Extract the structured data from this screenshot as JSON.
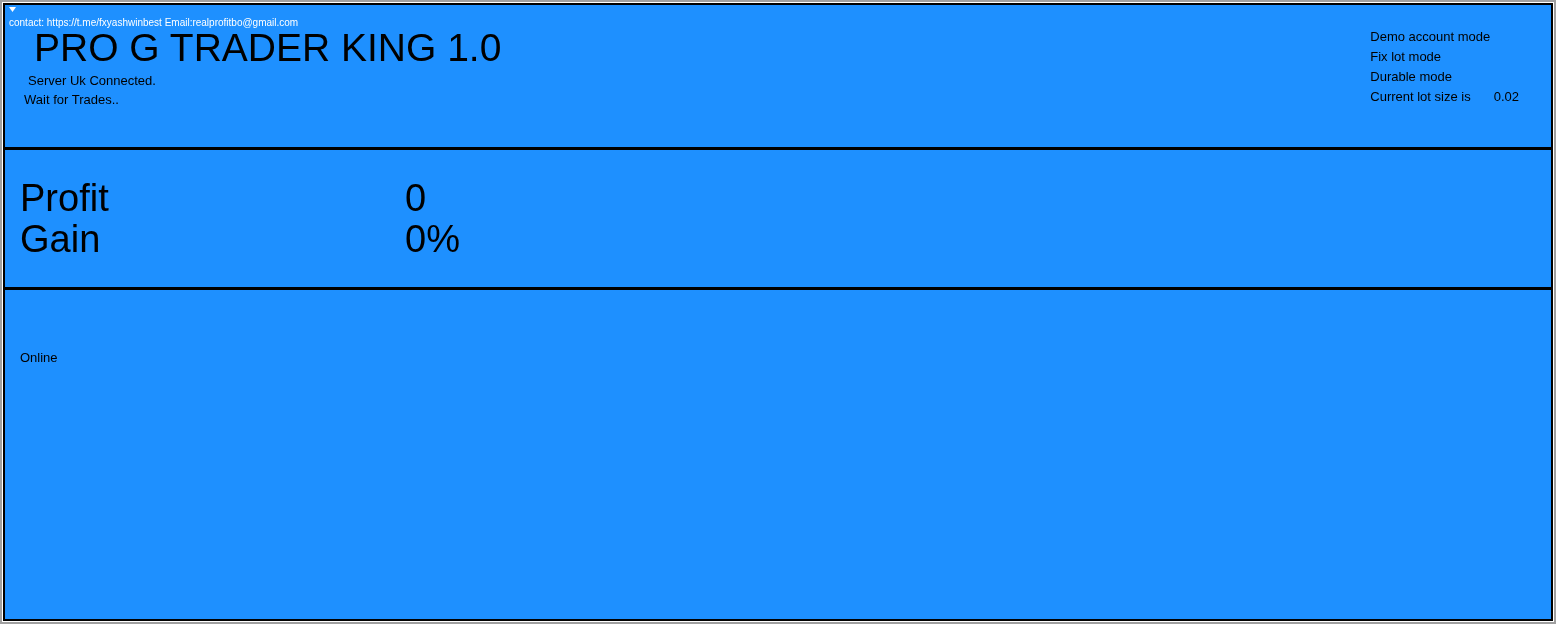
{
  "header": {
    "contact": "contact:  https://t.me/fxyashwinbest Email:realprofitbo@gmail.com",
    "title": "PRO G TRADER KING 1.0",
    "server_status": "Server Uk Connected.",
    "trade_status": "Wait for Trades..",
    "modes": [
      {
        "label": "Demo account mode"
      },
      {
        "label": "Fix lot mode"
      },
      {
        "label": "Durable mode"
      },
      {
        "label": "Current lot size is",
        "value": "0.02"
      }
    ]
  },
  "stats": [
    {
      "label": "Profit",
      "value": "0"
    },
    {
      "label": "Gain",
      "value": "0%"
    }
  ],
  "footer": {
    "status": "Online"
  }
}
